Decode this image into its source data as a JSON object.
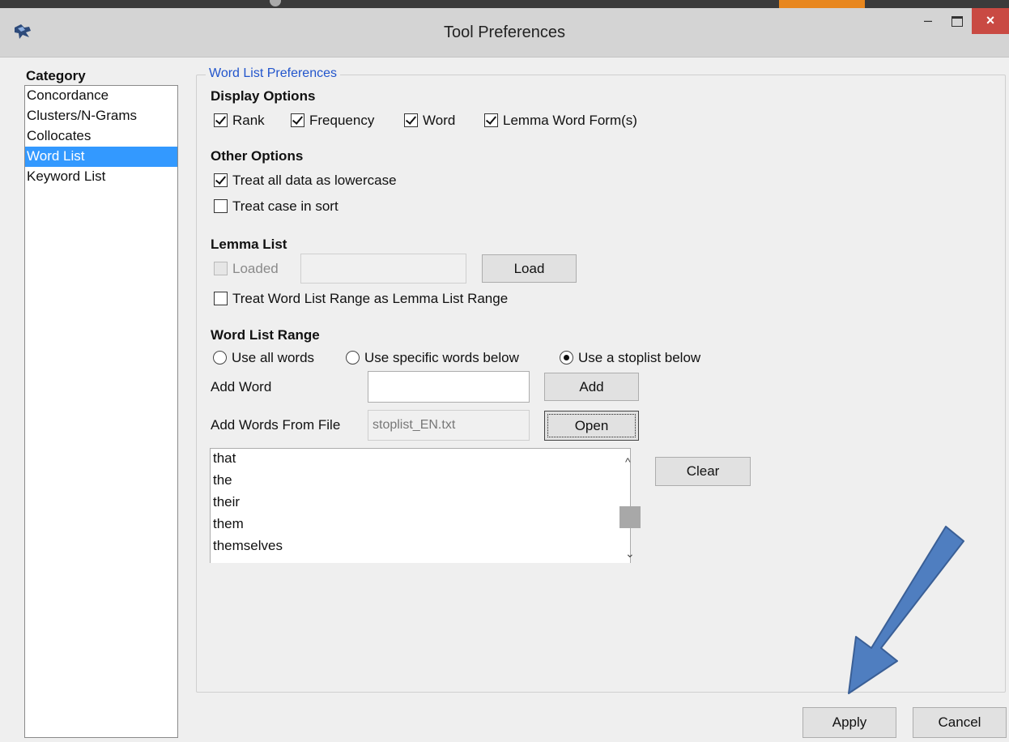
{
  "window": {
    "title": "Tool Preferences",
    "minimize_label": "–",
    "close_label": "×"
  },
  "category": {
    "label": "Category",
    "items": [
      "Concordance",
      "Clusters/N-Grams",
      "Collocates",
      "Word List",
      "Keyword List"
    ],
    "selected": "Word List"
  },
  "panel": {
    "title": "Word List Preferences",
    "display_options": {
      "heading": "Display Options",
      "rank": {
        "label": "Rank",
        "checked": true
      },
      "frequency": {
        "label": "Frequency",
        "checked": true
      },
      "word": {
        "label": "Word",
        "checked": true
      },
      "lemma": {
        "label": "Lemma Word Form(s)",
        "checked": true
      }
    },
    "other_options": {
      "heading": "Other Options",
      "lowercase": {
        "label": "Treat all data as lowercase",
        "checked": true
      },
      "case_sort": {
        "label": "Treat case in sort",
        "checked": false
      }
    },
    "lemma_list": {
      "heading": "Lemma List",
      "loaded_label": "Loaded",
      "load_button": "Load",
      "range_label": "Treat Word List Range as Lemma List Range"
    },
    "word_list_range": {
      "heading": "Word List Range",
      "radio_all": "Use all words",
      "radio_specific": "Use specific words below",
      "radio_stoplist": "Use a stoplist below",
      "selected": "Use a stoplist below",
      "add_word_label": "Add Word",
      "add_button": "Add",
      "add_from_file_label": "Add Words From File",
      "file_value": "stoplist_EN.txt",
      "open_button": "Open",
      "clear_button": "Clear",
      "words": [
        "that",
        "the",
        "their",
        "them",
        "themselves"
      ]
    }
  },
  "footer": {
    "apply_button": "Apply",
    "cancel_button": "Cancel"
  },
  "colors": {
    "selection": "#3399ff",
    "close_button": "#c94a43",
    "arrow_fill": "#4f7ec0",
    "group_title": "#2255cc"
  }
}
